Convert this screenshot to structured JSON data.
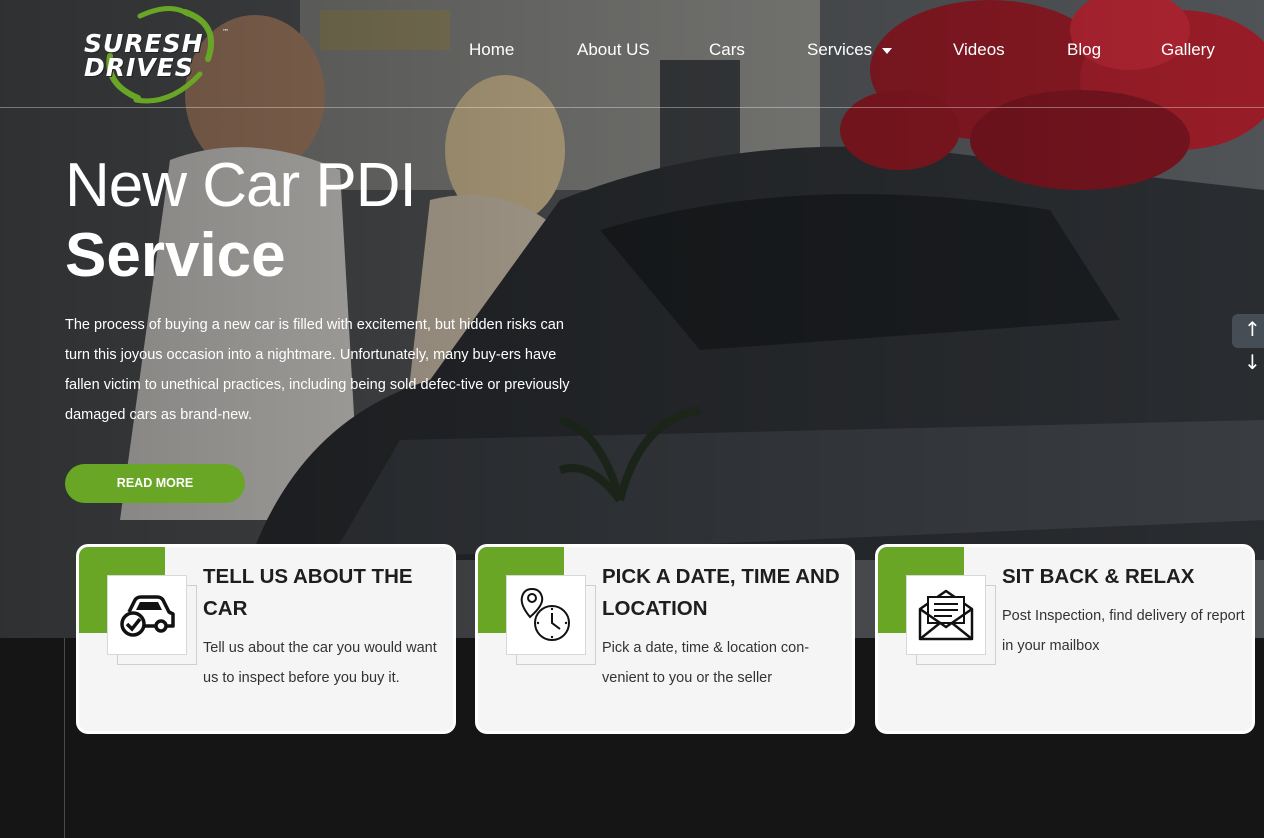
{
  "brand": {
    "logo_line1": "SURESH",
    "logo_line2": "DRIVES",
    "logo_tm": "™",
    "accent_color": "#6aa626"
  },
  "nav": {
    "items": [
      {
        "label": "Home"
      },
      {
        "label": "About US"
      },
      {
        "label": "Cars"
      },
      {
        "label": "Services",
        "has_dropdown": true
      },
      {
        "label": "Videos"
      },
      {
        "label": "Blog"
      },
      {
        "label": "Gallery"
      }
    ]
  },
  "hero": {
    "title_light": "New Car PDI",
    "title_bold": "Service",
    "description": "The process of buying a new car is filled with excitement, but hidden risks can turn this joyous occasion into a nightmare. Unfortunately, many buy-ers have fallen victim to unethical practices, including being sold defec-tive or previously damaged cars as brand-new.",
    "cta_label": "READ MORE",
    "scroll_up": "↑",
    "scroll_down": "↓"
  },
  "cards": [
    {
      "icon": "car-check-icon",
      "title": "TELL US ABOUT THE CAR",
      "text": "Tell us about the car you would want us to inspect before you buy it."
    },
    {
      "icon": "location-clock-icon",
      "title": "PICK A DATE, TIME AND LOCATION",
      "text": "Pick a date, time & location con-venient to you or the seller"
    },
    {
      "icon": "envelope-icon",
      "title": "SIT BACK & RELAX",
      "text": "Post Inspection, find delivery of report in your mailbox"
    }
  ]
}
